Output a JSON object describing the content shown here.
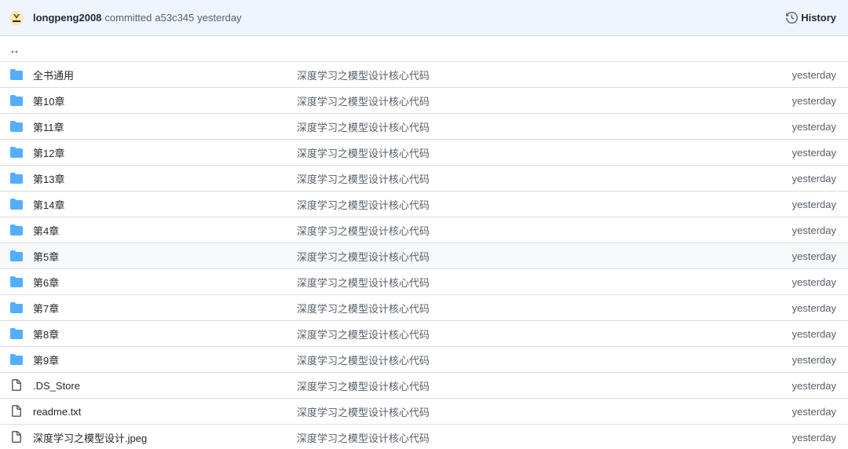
{
  "commit": {
    "avatar_text": "鸭王AI",
    "author": "longpeng2008",
    "action": "committed",
    "hash": "a53c345",
    "time": "yesterday",
    "history_label": "History"
  },
  "parent_link": "..",
  "colors": {
    "folder": "#54aeff",
    "header_bg": "#f0f5fd",
    "border": "#d8dee4",
    "link": "#0969da"
  },
  "files": [
    {
      "type": "folder",
      "icon": "folder-icon",
      "name": "全书通用",
      "message": "深度学习之模型设计核心代码",
      "age": "yesterday"
    },
    {
      "type": "folder",
      "icon": "folder-icon",
      "name": "第10章",
      "message": "深度学习之模型设计核心代码",
      "age": "yesterday"
    },
    {
      "type": "folder",
      "icon": "folder-icon",
      "name": "第11章",
      "message": "深度学习之模型设计核心代码",
      "age": "yesterday"
    },
    {
      "type": "folder",
      "icon": "folder-icon",
      "name": "第12章",
      "message": "深度学习之模型设计核心代码",
      "age": "yesterday"
    },
    {
      "type": "folder",
      "icon": "folder-icon",
      "name": "第13章",
      "message": "深度学习之模型设计核心代码",
      "age": "yesterday"
    },
    {
      "type": "folder",
      "icon": "folder-icon",
      "name": "第14章",
      "message": "深度学习之模型设计核心代码",
      "age": "yesterday"
    },
    {
      "type": "folder",
      "icon": "folder-icon",
      "name": "第4章",
      "message": "深度学习之模型设计核心代码",
      "age": "yesterday"
    },
    {
      "type": "folder",
      "icon": "folder-icon",
      "name": "第5章",
      "message": "深度学习之模型设计核心代码",
      "age": "yesterday",
      "highlight": true
    },
    {
      "type": "folder",
      "icon": "folder-icon",
      "name": "第6章",
      "message": "深度学习之模型设计核心代码",
      "age": "yesterday"
    },
    {
      "type": "folder",
      "icon": "folder-icon",
      "name": "第7章",
      "message": "深度学习之模型设计核心代码",
      "age": "yesterday"
    },
    {
      "type": "folder",
      "icon": "folder-icon",
      "name": "第8章",
      "message": "深度学习之模型设计核心代码",
      "age": "yesterday"
    },
    {
      "type": "folder",
      "icon": "folder-icon",
      "name": "第9章",
      "message": "深度学习之模型设计核心代码",
      "age": "yesterday"
    },
    {
      "type": "file",
      "icon": "file-icon",
      "name": ".DS_Store",
      "message": "深度学习之模型设计核心代码",
      "age": "yesterday"
    },
    {
      "type": "file",
      "icon": "file-icon",
      "name": "readme.txt",
      "message": "深度学习之模型设计核心代码",
      "age": "yesterday"
    },
    {
      "type": "file",
      "icon": "file-icon",
      "name": "深度学习之模型设计.jpeg",
      "message": "深度学习之模型设计核心代码",
      "age": "yesterday"
    }
  ]
}
